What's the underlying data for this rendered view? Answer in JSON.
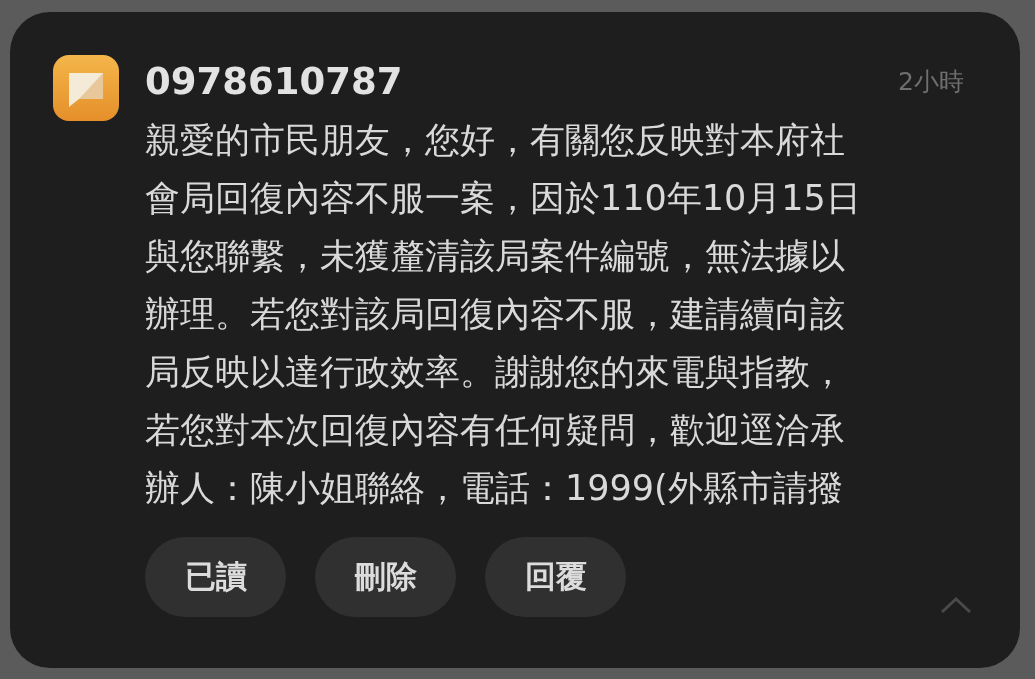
{
  "notification": {
    "sender": "0978610787",
    "time": "2小時",
    "message_lines": [
      "親愛的市民朋友，您好，有關您反映對本府社",
      "會局回復內容不服一案，因於110年10月15日",
      "與您聯繫，未獲釐清該局案件編號，無法據以",
      "辦理。若您對該局回復內容不服，建請續向該",
      "局反映以達行政效率。謝謝您的來電與指教，",
      "若您對本次回復內容有任何疑問，歡迎逕洽承",
      "辦人：陳小姐聯絡，電話：1999(外縣市請撥"
    ],
    "actions": [
      "已讀",
      "刪除",
      "回覆"
    ]
  }
}
